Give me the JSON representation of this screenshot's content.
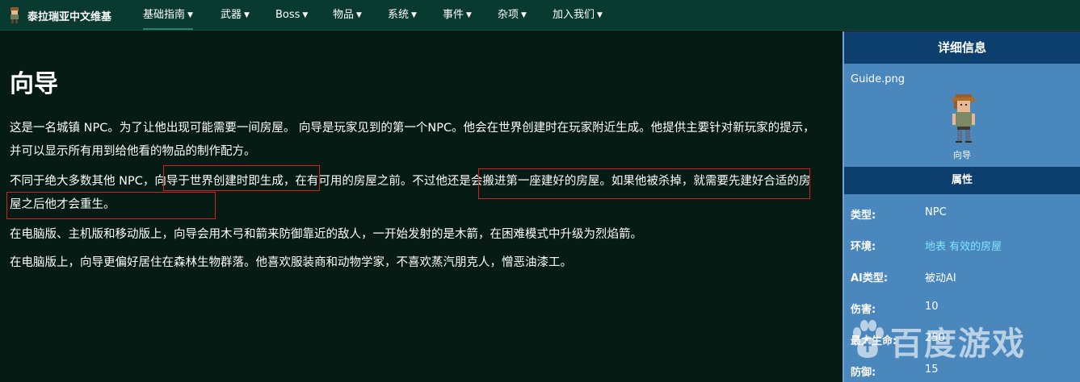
{
  "nav": {
    "brand": "泰拉瑞亚中文维基",
    "items": [
      {
        "label": "基础指南"
      },
      {
        "label": "武器"
      },
      {
        "label": "Boss"
      },
      {
        "label": "物品"
      },
      {
        "label": "系统"
      },
      {
        "label": "事件"
      },
      {
        "label": "杂项"
      },
      {
        "label": "加入我们"
      }
    ]
  },
  "article": {
    "title": "向导",
    "paragraphs": [
      "这是一名城镇 NPC。为了让他出现可能需要一间房屋。 向导是玩家见到的第一个NPC。他会在世界创建时在玩家附近生成。他提供主要针对新玩家的提示，并可以显示所有用到给他看的物品的制作配方。",
      "不同于绝大多数其他 NPC，向导于世界创建时即生成，在有可用的房屋之前。不过他还是会搬进第一座建好的房屋。如果他被杀掉，就需要先建好合适的房屋之后他才会重生。",
      "在电脑版、主机版和移动版上，向导会用木弓和箭来防御靠近的敌人，一开始发射的是木箭，在困难模式中升级为烈焰箭。",
      "在电脑版上，向导更偏好居住在森林生物群落。他喜欢服装商和动物学家，不喜欢蒸汽朋克人，憎恶油漆工。"
    ]
  },
  "infobox": {
    "header": "详细信息",
    "file": "Guide.png",
    "caption": "向导",
    "section": "属性",
    "rows": [
      {
        "label": "类型:",
        "value": "NPC"
      },
      {
        "label": "环境:",
        "value": "地表 有效的房屋"
      },
      {
        "label": "AI类型:",
        "value": "被动AI"
      },
      {
        "label": "伤害:",
        "value": "10"
      },
      {
        "label": "最大生命:",
        "value": "250"
      },
      {
        "label": "防御:",
        "value": "15"
      }
    ]
  },
  "watermark": "百度游戏",
  "colors": {
    "background": "#051b14",
    "navbar": "#083a2f",
    "infobox": "#4a87bd",
    "infobox_header": "#0d3f6e",
    "highlight_box": "#d81e1e",
    "link": "#7fe3ff"
  }
}
